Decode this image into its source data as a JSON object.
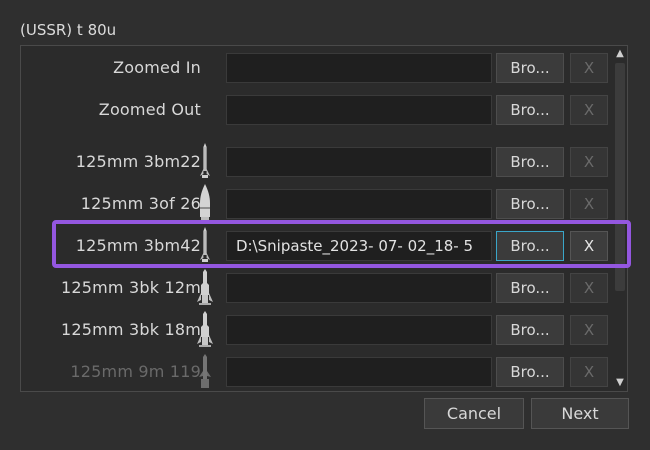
{
  "window": {
    "title": "(USSR) t 80u"
  },
  "rows": [
    {
      "label": "Zoomed In",
      "icon": "none",
      "value": "",
      "browse": "Bro...",
      "clear": "X"
    },
    {
      "label": "Zoomed Out",
      "icon": "none",
      "value": "",
      "browse": "Bro...",
      "clear": "X"
    },
    {
      "label": "125mm 3bm22",
      "icon": "apfsds-dart-icon",
      "value": "",
      "browse": "Bro...",
      "clear": "X"
    },
    {
      "label": "125mm 3of 26",
      "icon": "he-shell-icon",
      "value": "",
      "browse": "Bro...",
      "clear": "X"
    },
    {
      "label": "125mm 3bm42",
      "icon": "apfsds-dart-icon",
      "value": "D:\\Snipaste_2023- 07- 02_18- 5",
      "browse": "Bro...",
      "clear": "X"
    },
    {
      "label": "125mm 3bk 12m",
      "icon": "heat-shell-icon",
      "value": "",
      "browse": "Bro...",
      "clear": "X"
    },
    {
      "label": "125mm 3bk 18m",
      "icon": "heat-shell-icon",
      "value": "",
      "browse": "Bro...",
      "clear": "X"
    },
    {
      "label": "125mm 9m 119",
      "icon": "atgm-missile-icon",
      "value": "",
      "browse": "Bro...",
      "clear": "X"
    }
  ],
  "footer": {
    "cancel": "Cancel",
    "next": "Next"
  },
  "colors": {
    "highlight": "#9457e0",
    "focus": "#3aa6c9",
    "background": "#2f2f2f"
  }
}
